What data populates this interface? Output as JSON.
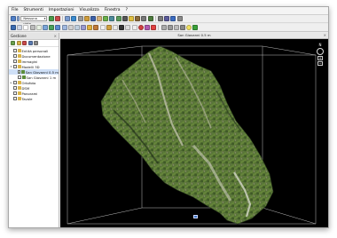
{
  "menubar": {
    "items": [
      "File",
      "Strumenti",
      "Impostazioni",
      "Visualizza",
      "Finestra",
      "?"
    ]
  },
  "toolbar": {
    "view_combo": "Nessuna vista"
  },
  "panel": {
    "title": "Gestione",
    "close": "×"
  },
  "tree": {
    "items": [
      {
        "label": "Entità personali",
        "level": 0,
        "expander": "",
        "checked": false,
        "selected": false,
        "icon_color": "#d9b44a"
      },
      {
        "label": "Documentazione",
        "level": 0,
        "expander": "",
        "checked": false,
        "selected": false,
        "icon_color": "#d9b44a"
      },
      {
        "label": "Immagini",
        "level": 0,
        "expander": "",
        "checked": false,
        "selected": false,
        "icon_color": "#d9b44a"
      },
      {
        "label": "Modelli 3D",
        "level": 0,
        "expander": "▾",
        "checked": false,
        "selected": false,
        "icon_color": "#d9b44a"
      },
      {
        "label": "San Giovanni 0.5 m",
        "level": 1,
        "expander": "",
        "checked": true,
        "selected": true,
        "icon_color": "#5d8d3a"
      },
      {
        "label": "San Giovanni 1 m",
        "level": 1,
        "expander": "",
        "checked": false,
        "selected": false,
        "icon_color": "#5d8d3a"
      },
      {
        "label": "Ortofoto",
        "level": 0,
        "expander": "▸",
        "checked": false,
        "selected": false,
        "icon_color": "#d9b44a"
      },
      {
        "label": "DSM",
        "level": 0,
        "expander": "",
        "checked": false,
        "selected": false,
        "icon_color": "#d9b44a"
      },
      {
        "label": "Panorami",
        "level": 0,
        "expander": "",
        "checked": false,
        "selected": false,
        "icon_color": "#d9b44a"
      },
      {
        "label": "Tavole",
        "level": 0,
        "expander": "",
        "checked": false,
        "selected": false,
        "icon_color": "#d9b44a"
      }
    ]
  },
  "viewport": {
    "tab_title": "San Giovanni 0.5 m",
    "tab_close": "×",
    "compass_north": "N",
    "zoom_in": "+",
    "zoom_out": "−"
  },
  "colors": {
    "window_bg": "#ececec",
    "viewport_bg": "#000000",
    "selection": "#cfe0f7",
    "bounding_box": "#bdbdbd"
  }
}
